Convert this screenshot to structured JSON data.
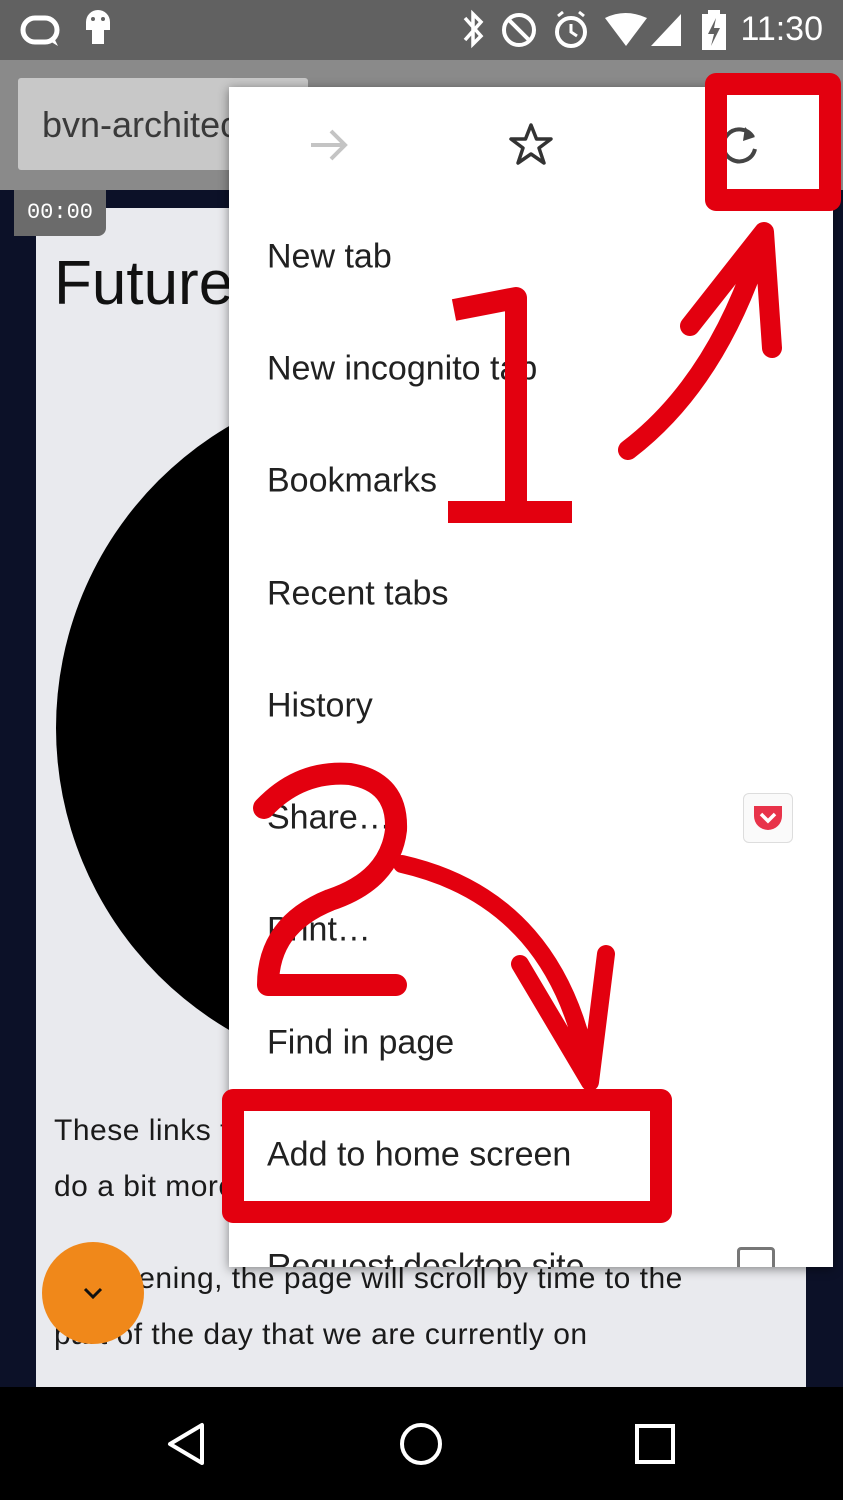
{
  "status_bar": {
    "time": "11:30"
  },
  "toolbar": {
    "url": "bvn-architecture"
  },
  "page": {
    "video_time": "00:00",
    "title": "Future",
    "para1_line1": "These links take you to pages that",
    "para1_line2": "do a bit more than the average page.",
    "para2_line1": "On opening, the page will scroll by time to the",
    "para2_line2": "part of the day that we are currently on"
  },
  "menu": {
    "items": [
      {
        "label": "New tab"
      },
      {
        "label": "New incognito tab"
      },
      {
        "label": "Bookmarks"
      },
      {
        "label": "Recent tabs"
      },
      {
        "label": "History"
      },
      {
        "label": "Share…"
      },
      {
        "label": "Print…"
      },
      {
        "label": "Find in page"
      },
      {
        "label": "Add to home screen"
      },
      {
        "label": "Request desktop site"
      }
    ]
  },
  "annotations": {
    "step1": "1",
    "step2": "2",
    "color": "#e3000f"
  },
  "colors": {
    "accent_orange": "#f0881a",
    "status_bar": "#616161",
    "toolbar": "#8a8a8a"
  }
}
